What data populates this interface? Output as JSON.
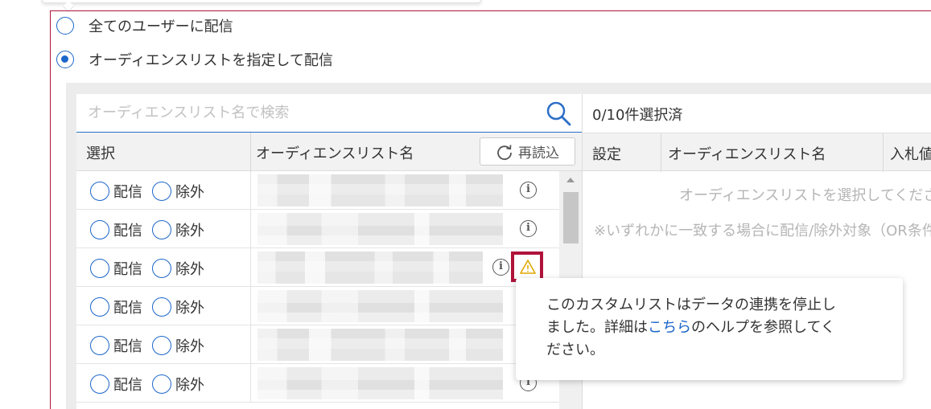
{
  "delivery": {
    "option_all": "全てのユーザーに配信",
    "option_audience": "オーディエンスリストを指定して配信",
    "selected": "option_audience"
  },
  "search": {
    "placeholder": "オーディエンスリスト名で検索",
    "value": ""
  },
  "left_table": {
    "col_select": "選択",
    "col_name": "オーディエンスリスト名",
    "reload_label": "再読込",
    "rows": [
      {
        "deliver": "配信",
        "exclude": "除外",
        "name_blurred": true,
        "info": true,
        "warning": false
      },
      {
        "deliver": "配信",
        "exclude": "除外",
        "name_blurred": true,
        "info": true,
        "warning": false
      },
      {
        "deliver": "配信",
        "exclude": "除外",
        "name_blurred": true,
        "info": true,
        "warning": true
      },
      {
        "deliver": "配信",
        "exclude": "除外",
        "name_blurred": true,
        "info": false,
        "warning": false
      },
      {
        "deliver": "配信",
        "exclude": "除外",
        "name_blurred": true,
        "info": false,
        "warning": false
      },
      {
        "deliver": "配信",
        "exclude": "除外",
        "name_blurred": true,
        "info": true,
        "warning": false
      }
    ]
  },
  "right_table": {
    "count_label": "0/10件選択済",
    "col_setting": "設定",
    "col_name": "オーディエンスリスト名",
    "col_bid": "入札値",
    "empty_message": "オーディエンスリストを選択してください",
    "note": "※いずれかに一致する場合に配信/除外対象（OR条件）"
  },
  "tooltip": {
    "text_before": "このカスタムリストはデータの連携を停止し",
    "text_line2_before": "ました。詳細は",
    "link_text": "こちら",
    "text_line2_after": "のヘルプを参照してく",
    "text_line3": "ださい。"
  },
  "colors": {
    "accent": "#1b66c9",
    "frame_border": "#b0153a",
    "warning": "#e0a800",
    "highlight": "#b0133a"
  },
  "icons": {
    "search": "search-icon",
    "reload": "reload-icon",
    "info": "info-icon",
    "warning": "warning-icon"
  }
}
